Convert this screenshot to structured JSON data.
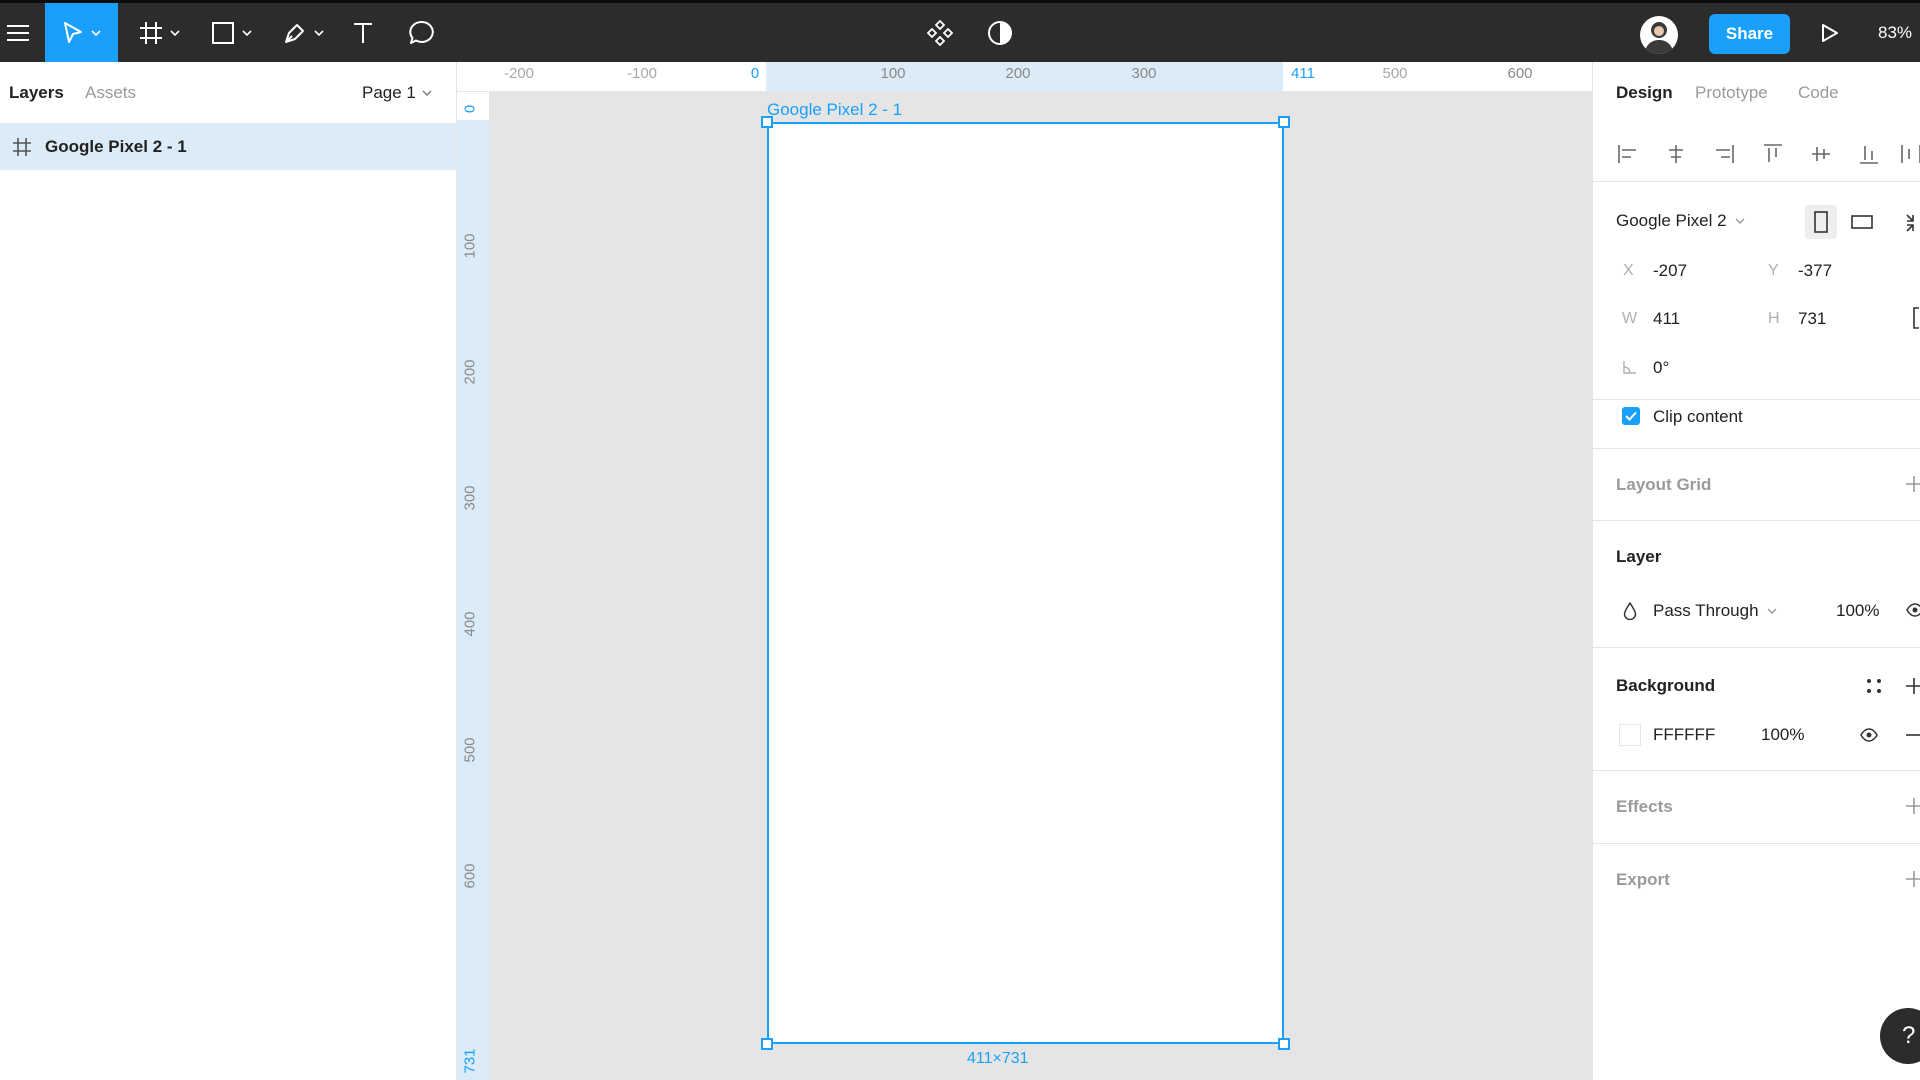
{
  "toolbar": {
    "share_label": "Share",
    "zoom_label": "83%",
    "icons": [
      "menu-icon",
      "move-icon",
      "frame-icon",
      "rectangle-icon",
      "pen-icon",
      "text-icon",
      "comment-icon",
      "component-icon",
      "mask-icon",
      "play-icon"
    ]
  },
  "left_panel": {
    "tabs": [
      "Layers",
      "Assets"
    ],
    "page_label": "Page 1",
    "layers": [
      {
        "name": "Google Pixel 2 - 1",
        "icon": "frame-hash-icon"
      }
    ]
  },
  "rulers": {
    "top": [
      "-200",
      "-100",
      "0",
      "100",
      "200",
      "300",
      "411",
      "500",
      "600"
    ],
    "left": [
      "0",
      "100",
      "200",
      "300",
      "400",
      "500",
      "600",
      "731"
    ]
  },
  "canvas": {
    "frame_title": "Google Pixel 2 - 1",
    "frame_size": "411×731"
  },
  "right_panel": {
    "tabs": [
      "Design",
      "Prototype",
      "Code"
    ],
    "frame": {
      "preset": "Google Pixel 2",
      "x_label": "X",
      "x": "-207",
      "y_label": "Y",
      "y": "-377",
      "w_label": "W",
      "w": "411",
      "h_label": "H",
      "h": "731",
      "rotation": "0°",
      "clip_content": "Clip content"
    },
    "layout_grid": "Layout Grid",
    "layer": {
      "title": "Layer",
      "blend": "Pass Through",
      "opacity": "100%"
    },
    "background": {
      "title": "Background",
      "hex": "FFFFFF",
      "opacity": "100%"
    },
    "effects": "Effects",
    "export": "Export"
  },
  "colors": {
    "accent": "#18a0fb",
    "toolbar": "#2c2c2c",
    "selection": "#dbebf7"
  },
  "help": "?"
}
